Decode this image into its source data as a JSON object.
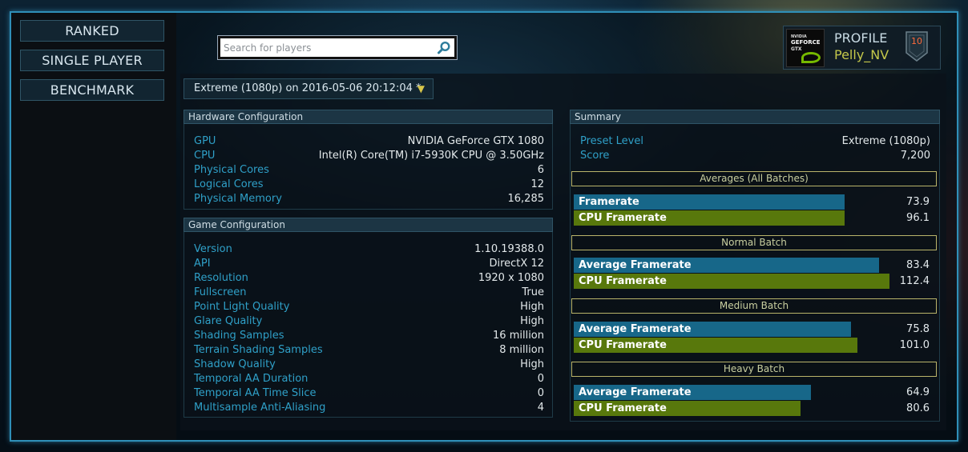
{
  "nav": {
    "ranked": "RANKED",
    "single_player": "SINGLE PLAYER",
    "benchmark": "BENCHMARK"
  },
  "search": {
    "placeholder": "Search for players",
    "value": ""
  },
  "profile": {
    "title": "PROFILE",
    "name": "Pelly_NV",
    "rank": "10",
    "logo_line1": "NVIDIA",
    "logo_line2": "GEFORCE",
    "logo_line3": "GTX"
  },
  "preset": {
    "selected": "Extreme (1080p) on 2016-05-06 20:12:04 *",
    "caret": "▼"
  },
  "hardware": {
    "title": "Hardware Configuration",
    "rows": [
      {
        "label": "GPU",
        "value": "NVIDIA GeForce GTX 1080"
      },
      {
        "label": "CPU",
        "value": "Intel(R) Core(TM) i7-5930K CPU @ 3.50GHz"
      },
      {
        "label": "Physical Cores",
        "value": "6"
      },
      {
        "label": "Logical Cores",
        "value": "12"
      },
      {
        "label": "Physical Memory",
        "value": "16,285"
      }
    ]
  },
  "game": {
    "title": "Game Configuration",
    "rows": [
      {
        "label": "Version",
        "value": "1.10.19388.0"
      },
      {
        "label": "API",
        "value": "DirectX 12"
      },
      {
        "label": "Resolution",
        "value": "1920 x 1080"
      },
      {
        "label": "Fullscreen",
        "value": "True"
      },
      {
        "label": "Point Light Quality",
        "value": "High"
      },
      {
        "label": "Glare Quality",
        "value": "High"
      },
      {
        "label": "Shading Samples",
        "value": "16 million"
      },
      {
        "label": "Terrain Shading Samples",
        "value": "8 million"
      },
      {
        "label": "Shadow Quality",
        "value": "High"
      },
      {
        "label": "Temporal AA Duration",
        "value": "0"
      },
      {
        "label": "Temporal AA Time Slice",
        "value": "0"
      },
      {
        "label": "Multisample Anti-Aliasing",
        "value": "4"
      }
    ]
  },
  "summary": {
    "title": "Summary",
    "rows": [
      {
        "label": "Preset Level",
        "value": "Extreme (1080p)"
      },
      {
        "label": "Score",
        "value": "7,200"
      }
    ],
    "batches": [
      {
        "title": "Averages (All Batches)",
        "bars": [
          {
            "label": "Framerate",
            "value": "73.9",
            "fraction": 0.75
          },
          {
            "label": "CPU Framerate",
            "value": "96.1",
            "fraction": 0.75
          }
        ]
      },
      {
        "title": "Normal Batch",
        "bars": [
          {
            "label": "Average Framerate",
            "value": "83.4",
            "fraction": 0.847
          },
          {
            "label": "CPU Framerate",
            "value": "112.4",
            "fraction": 0.876
          }
        ]
      },
      {
        "title": "Medium Batch",
        "bars": [
          {
            "label": "Average Framerate",
            "value": "75.8",
            "fraction": 0.768
          },
          {
            "label": "CPU Framerate",
            "value": "101.0",
            "fraction": 0.787
          }
        ]
      },
      {
        "title": "Heavy Batch",
        "bars": [
          {
            "label": "Average Framerate",
            "value": "64.9",
            "fraction": 0.658
          },
          {
            "label": "CPU Framerate",
            "value": "80.6",
            "fraction": 0.628
          }
        ]
      }
    ]
  },
  "colors": {
    "accent_frame": "#2f8fb8",
    "label_blue": "#2fa0c8",
    "bar_blue": "#176789",
    "bar_green": "#58780c",
    "batch_border": "#b9b46a",
    "profile_name": "#c4c84a"
  }
}
